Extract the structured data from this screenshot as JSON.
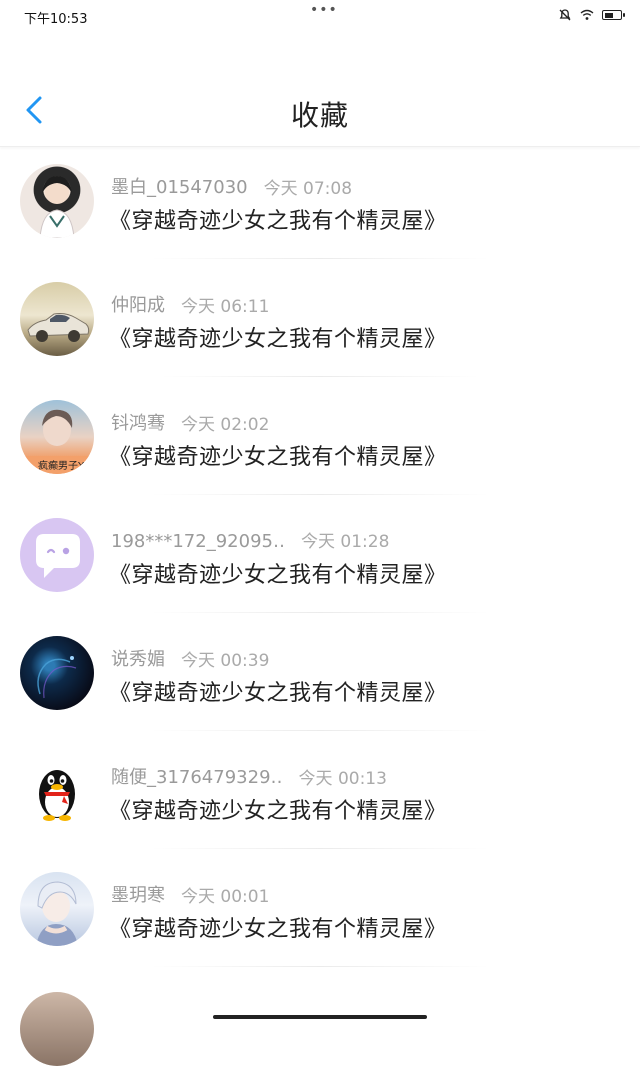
{
  "status_bar": {
    "time": "下午10:53",
    "dots": "•••",
    "icons": [
      "mute-icon",
      "wifi-icon",
      "battery-icon"
    ]
  },
  "header": {
    "back_icon": "chevron-left-icon",
    "title": "收藏",
    "accent": "#2196f3"
  },
  "favorites": [
    {
      "name": "墨白_01547030",
      "time": "今天 07:08",
      "book": "《穿越奇迹少女之我有个精灵屋》",
      "avatar": "girl-avatar"
    },
    {
      "name": "仲阳成",
      "time": "今天 06:11",
      "book": "《穿越奇迹少女之我有个精灵屋》",
      "avatar": "car-avatar"
    },
    {
      "name": "钭鸿骞",
      "time": "今天 02:02",
      "book": "《穿越奇迹少女之我有个精灵屋》",
      "avatar": "guy-avatar",
      "avatar_caption": "疯癫男子Y"
    },
    {
      "name": "198***172_92095‥",
      "time": "今天 01:28",
      "book": "《穿越奇迹少女之我有个精灵屋》",
      "avatar": "chat-bubble-avatar"
    },
    {
      "name": "说秀媚",
      "time": "今天 00:39",
      "book": "《穿越奇迹少女之我有个精灵屋》",
      "avatar": "dark-abstract-avatar"
    },
    {
      "name": "随便_3176479329‥",
      "time": "今天 00:13",
      "book": "《穿越奇迹少女之我有个精灵屋》",
      "avatar": "penguin-avatar"
    },
    {
      "name": "墨玥寒",
      "time": "今天 00:01",
      "book": "《穿越奇迹少女之我有个精灵屋》",
      "avatar": "anime-avatar"
    }
  ]
}
